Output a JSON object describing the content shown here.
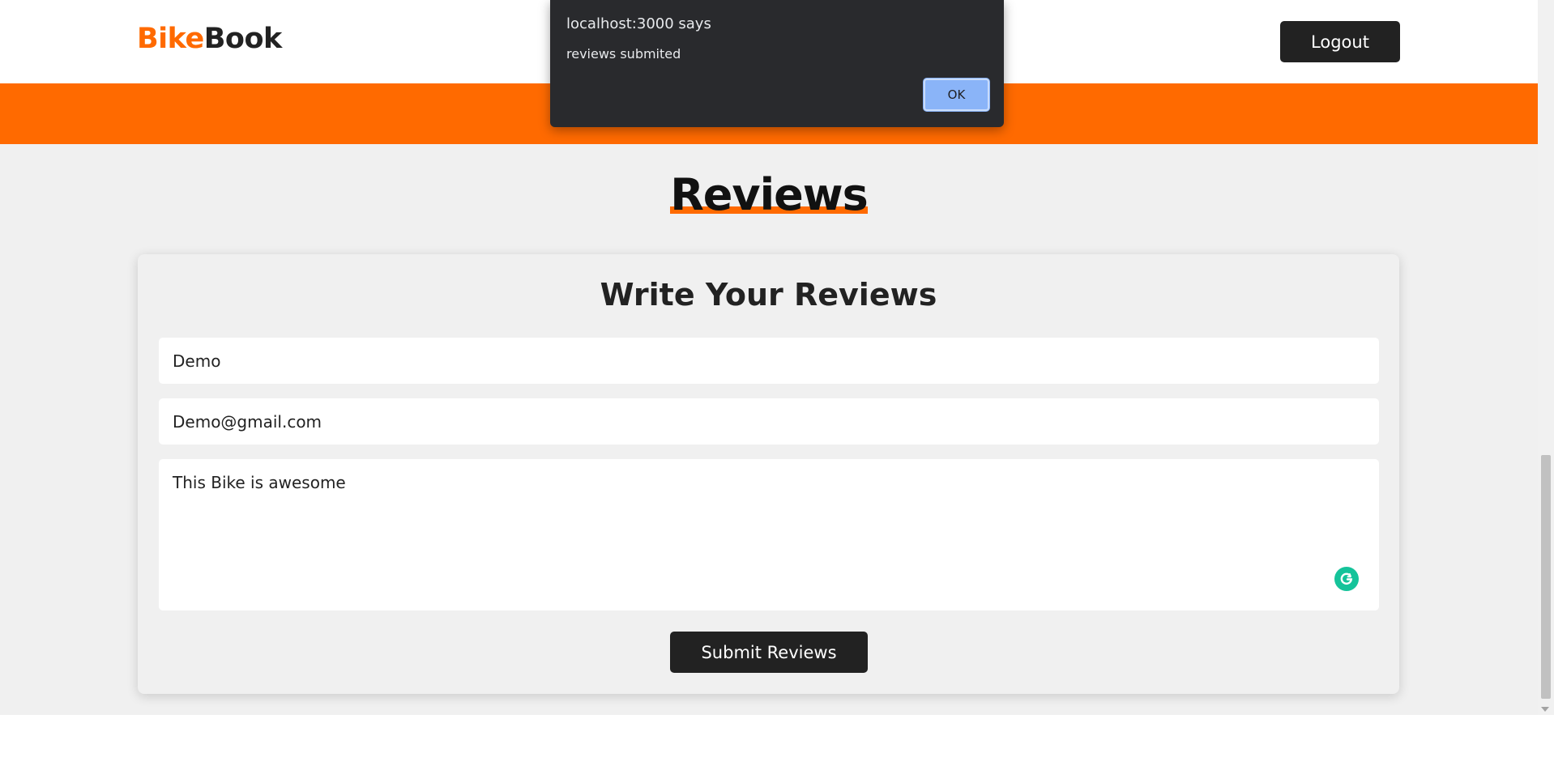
{
  "header": {
    "logo_part1": "Bike",
    "logo_part2": "Book",
    "logout_label": "Logout"
  },
  "reviews_section": {
    "title": "Reviews",
    "form": {
      "title": "Write Your Reviews",
      "name_value": "Demo",
      "email_value": "Demo@gmail.com",
      "review_value": "This Bike is awesome",
      "submit_label": "Submit Reviews"
    }
  },
  "alert_dialog": {
    "title": "localhost:3000 says",
    "message": "reviews submited",
    "ok_label": "OK"
  },
  "colors": {
    "accent": "#ff6a00",
    "dark": "#222222",
    "background": "#f0f0f0",
    "dialog_background": "#292a2d",
    "dialog_button": "#8ab4f8",
    "grammarly": "#15c39a"
  },
  "icons": {
    "grammarly": "grammarly-icon"
  }
}
